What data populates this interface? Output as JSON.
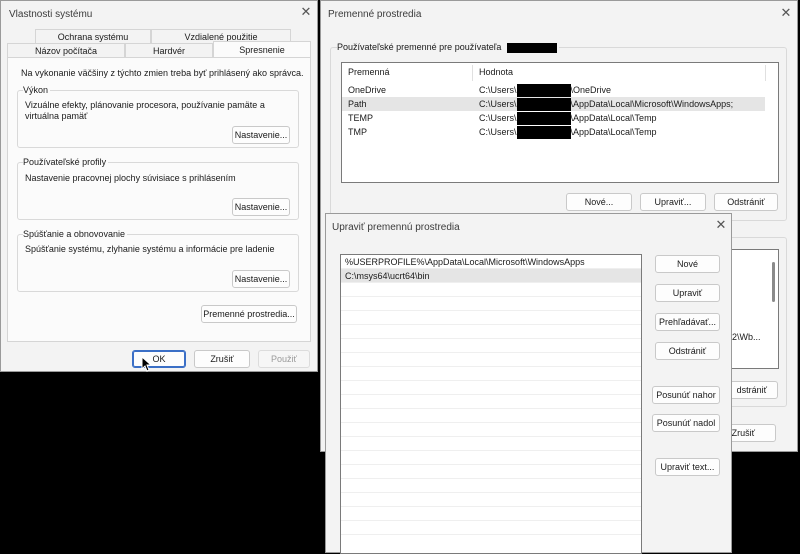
{
  "system_props": {
    "title": "Vlastnosti systému",
    "tabs_row1": [
      "Ochrana systému",
      "Vzdialené použitie"
    ],
    "tabs_row2": [
      "Názov počítača",
      "Hardvér",
      "Spresnenie"
    ],
    "admin_note": "Na vykonanie väčšiny z týchto zmien treba byť prihlásený ako správca.",
    "performance": {
      "title": "Výkon",
      "desc": "Vizuálne efekty, plánovanie procesora, používanie pamäte a virtuálna pamäť",
      "button": "Nastavenie..."
    },
    "profiles": {
      "title": "Používateľské profily",
      "desc": "Nastavenie pracovnej plochy súvisiace s prihlásením",
      "button": "Nastavenie..."
    },
    "startup": {
      "title": "Spúšťanie a obnovovanie",
      "desc": "Spúšťanie systému, zlyhanie systému a informácie pre ladenie",
      "button": "Nastavenie..."
    },
    "env_button": "Premenné prostredia...",
    "ok": "OK",
    "cancel": "Zrušiť",
    "apply": "Použiť"
  },
  "env_vars": {
    "title": "Premenné prostredia",
    "user_group_title": "Používateľské premenné pre používateľa",
    "columns": [
      "Premenná",
      "Hodnota"
    ],
    "rows": [
      {
        "name": "OneDrive",
        "prefix": "C:\\Users\\",
        "suffix": "\\OneDrive"
      },
      {
        "name": "Path",
        "prefix": "C:\\Users\\",
        "suffix": "\\AppData\\Local\\Microsoft\\WindowsApps;"
      },
      {
        "name": "TEMP",
        "prefix": "C:\\Users\\",
        "suffix": "\\AppData\\Local\\Temp"
      },
      {
        "name": "TMP",
        "prefix": "C:\\Users\\",
        "suffix": "\\AppData\\Local\\Temp"
      }
    ],
    "new": "Nové...",
    "edit": "Upraviť...",
    "delete": "Odstrániť",
    "partial_text": "2\\Wb...",
    "partial_delete": "dstrániť",
    "partial_cancel": "Zrušiť"
  },
  "edit_var": {
    "title": "Upraviť premennú prostredia",
    "entries": [
      "%USERPROFILE%\\AppData\\Local\\Microsoft\\WindowsApps",
      "C:\\msys64\\ucrt64\\bin"
    ],
    "buttons": {
      "new": "Nové",
      "edit": "Upraviť",
      "browse": "Prehľadávať...",
      "delete": "Odstrániť",
      "move_up": "Posunúť nahor",
      "move_down": "Posunúť nadol",
      "edit_text": "Upraviť text..."
    }
  },
  "close_glyph": "✕"
}
